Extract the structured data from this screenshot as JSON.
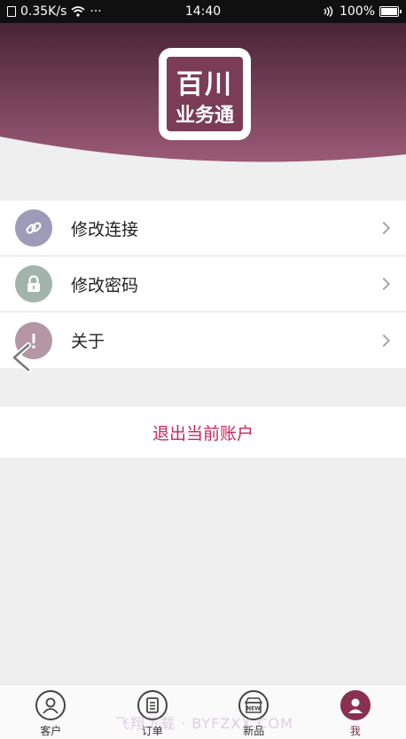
{
  "status_bar": {
    "speed": "0.35K/s",
    "dots": "···",
    "time": "14:40",
    "battery": "100%"
  },
  "header": {
    "logo_line1": "百川",
    "logo_line2": "业务通"
  },
  "menu": {
    "items": [
      {
        "label": "修改连接",
        "icon": "link-icon",
        "color": "#9d9bb8"
      },
      {
        "label": "修改密码",
        "icon": "lock-icon",
        "color": "#a2b4ab"
      },
      {
        "label": "关于",
        "icon": "info-icon",
        "color": "#b496a5"
      }
    ]
  },
  "logout": {
    "label": "退出当前账户",
    "color": "#c8295d"
  },
  "tabs": [
    {
      "label": "客户",
      "icon": "customer-icon"
    },
    {
      "label": "订单",
      "icon": "order-icon"
    },
    {
      "label": "新品",
      "icon": "new-products-icon"
    },
    {
      "label": "我",
      "icon": "me-icon",
      "active": true
    }
  ],
  "watermark": "飞翔下载 · BYFZXX.COM",
  "colors": {
    "accent": "#8a3050",
    "header_top": "#4a2437",
    "header_bottom": "#9b5a76"
  }
}
